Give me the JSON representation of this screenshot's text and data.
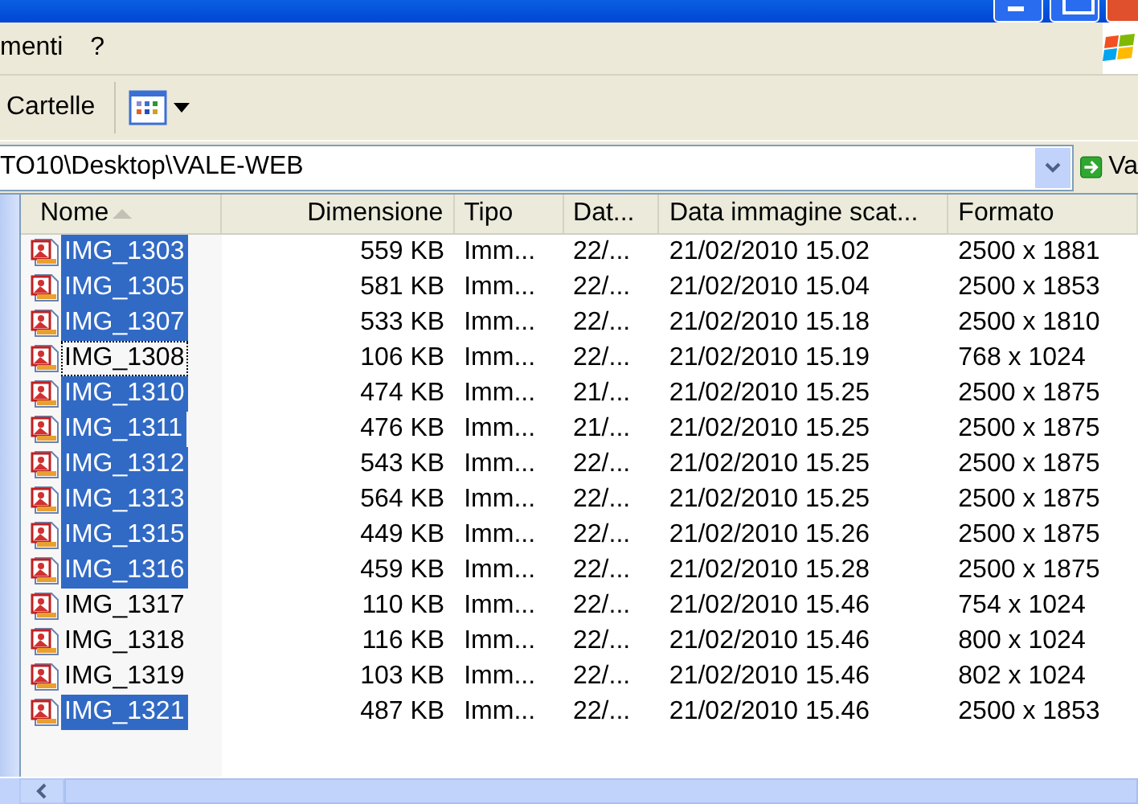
{
  "menu_bar": {
    "items": [
      "menti",
      "?"
    ]
  },
  "toolbar": {
    "folders_label": "Cartelle"
  },
  "address_bar": {
    "path": "TO10\\Desktop\\VALE-WEB",
    "go_label": "Va"
  },
  "table": {
    "columns": [
      {
        "label": "Nome",
        "sorted": true
      },
      {
        "label": "Dimensione",
        "sorted": false
      },
      {
        "label": "Tipo",
        "sorted": false
      },
      {
        "label": "Dat...",
        "sorted": false
      },
      {
        "label": "Data immagine scat...",
        "sorted": false
      },
      {
        "label": "Formato",
        "sorted": false
      }
    ],
    "rows": [
      {
        "name": "IMG_1303",
        "size": "559 KB",
        "type": "Imm...",
        "date": "22/...",
        "taken": "21/02/2010 15.02",
        "format": "2500 x 1881",
        "selected": true,
        "focused": false
      },
      {
        "name": "IMG_1305",
        "size": "581 KB",
        "type": "Imm...",
        "date": "22/...",
        "taken": "21/02/2010 15.04",
        "format": "2500 x 1853",
        "selected": true,
        "focused": false
      },
      {
        "name": "IMG_1307",
        "size": "533 KB",
        "type": "Imm...",
        "date": "22/...",
        "taken": "21/02/2010 15.18",
        "format": "2500 x 1810",
        "selected": true,
        "focused": false
      },
      {
        "name": "IMG_1308",
        "size": "106 KB",
        "type": "Imm...",
        "date": "22/...",
        "taken": "21/02/2010 15.19",
        "format": "768 x 1024",
        "selected": false,
        "focused": true
      },
      {
        "name": "IMG_1310",
        "size": "474 KB",
        "type": "Imm...",
        "date": "21/...",
        "taken": "21/02/2010 15.25",
        "format": "2500 x 1875",
        "selected": true,
        "focused": false
      },
      {
        "name": "IMG_1311",
        "size": "476 KB",
        "type": "Imm...",
        "date": "21/...",
        "taken": "21/02/2010 15.25",
        "format": "2500 x 1875",
        "selected": true,
        "focused": false
      },
      {
        "name": "IMG_1312",
        "size": "543 KB",
        "type": "Imm...",
        "date": "22/...",
        "taken": "21/02/2010 15.25",
        "format": "2500 x 1875",
        "selected": true,
        "focused": false
      },
      {
        "name": "IMG_1313",
        "size": "564 KB",
        "type": "Imm...",
        "date": "22/...",
        "taken": "21/02/2010 15.25",
        "format": "2500 x 1875",
        "selected": true,
        "focused": false
      },
      {
        "name": "IMG_1315",
        "size": "449 KB",
        "type": "Imm...",
        "date": "22/...",
        "taken": "21/02/2010 15.26",
        "format": "2500 x 1875",
        "selected": true,
        "focused": false
      },
      {
        "name": "IMG_1316",
        "size": "459 KB",
        "type": "Imm...",
        "date": "22/...",
        "taken": "21/02/2010 15.28",
        "format": "2500 x 1875",
        "selected": true,
        "focused": false
      },
      {
        "name": "IMG_1317",
        "size": "110 KB",
        "type": "Imm...",
        "date": "22/...",
        "taken": "21/02/2010 15.46",
        "format": "754 x 1024",
        "selected": false,
        "focused": false
      },
      {
        "name": "IMG_1318",
        "size": "116 KB",
        "type": "Imm...",
        "date": "22/...",
        "taken": "21/02/2010 15.46",
        "format": "800 x 1024",
        "selected": false,
        "focused": false
      },
      {
        "name": "IMG_1319",
        "size": "103 KB",
        "type": "Imm...",
        "date": "22/...",
        "taken": "21/02/2010 15.46",
        "format": "802 x 1024",
        "selected": false,
        "focused": false
      },
      {
        "name": "IMG_1321",
        "size": "487 KB",
        "type": "Imm...",
        "date": "22/...",
        "taken": "21/02/2010 15.46",
        "format": "2500 x 1853",
        "selected": true,
        "focused": false
      }
    ]
  }
}
